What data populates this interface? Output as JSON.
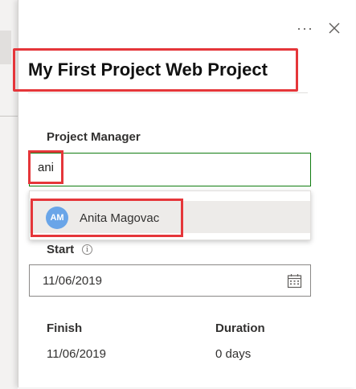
{
  "header": {
    "more_label": "···",
    "title": "My First Project Web Project"
  },
  "project_manager": {
    "label": "Project Manager",
    "value": "ani",
    "suggestions": [
      {
        "initials": "AM",
        "name": "Anita Magovac"
      }
    ]
  },
  "start": {
    "label": "Start",
    "info_glyph": "i",
    "value": "11/06/2019"
  },
  "finish": {
    "label": "Finish",
    "value": "11/06/2019"
  },
  "duration": {
    "label": "Duration",
    "value": "0 days"
  },
  "colors": {
    "accent_green": "#107c10",
    "highlight_red": "#e5363a",
    "avatar_blue": "#6aa5e8"
  }
}
